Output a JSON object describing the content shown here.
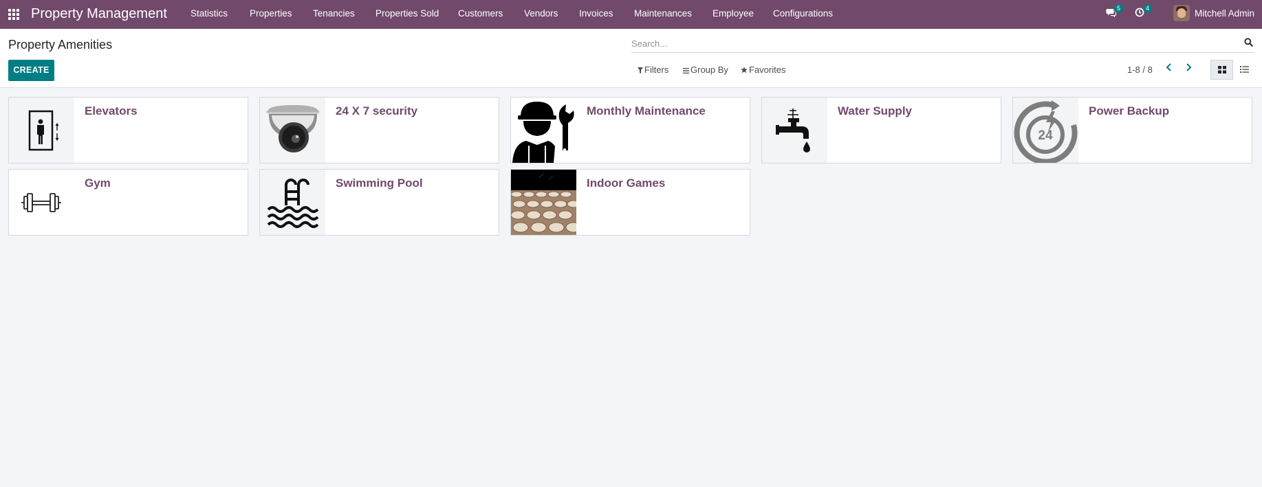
{
  "navbar": {
    "brand": "Property Management",
    "menu": [
      "Statistics",
      "Properties",
      "Tenancies",
      "Properties Sold",
      "Customers",
      "Vendors",
      "Invoices",
      "Maintenances",
      "Employee",
      "Configurations"
    ],
    "messages_count": "5",
    "activities_count": "4",
    "user_name": "Mitchell Admin"
  },
  "control": {
    "page_title": "Property Amenities",
    "create_label": "CREATE",
    "search_placeholder": "Search...",
    "filters_label": "Filters",
    "group_by_label": "Group By",
    "favorites_label": "Favorites",
    "pager_text": "1-8 / 8"
  },
  "icons": {
    "apps": "apps-grid-icon",
    "messages": "chat-icon",
    "activities": "clock-icon",
    "search": "search-icon",
    "filter": "filter-icon",
    "group_by": "bars-icon",
    "favorites": "star-icon",
    "prev": "chevron-left-icon",
    "next": "chevron-right-icon",
    "kanban_view": "kanban-view-icon",
    "list_view": "list-view-icon"
  },
  "amenities": [
    {
      "name": "Elevators",
      "image": "elevator"
    },
    {
      "name": "24 X 7 security",
      "image": "security-camera"
    },
    {
      "name": "Monthly Maintenance",
      "image": "maintenance-worker"
    },
    {
      "name": "Water Supply",
      "image": "water-tap"
    },
    {
      "name": "Power Backup",
      "image": "power-backup-24"
    },
    {
      "name": "Gym",
      "image": "dumbbell"
    },
    {
      "name": "Swimming Pool",
      "image": "swimming-pool"
    },
    {
      "name": "Indoor Games",
      "image": "chess-board-photo"
    }
  ],
  "colors": {
    "brand": "#71496b",
    "primary_button": "#017e84",
    "badge": "#017e84"
  }
}
